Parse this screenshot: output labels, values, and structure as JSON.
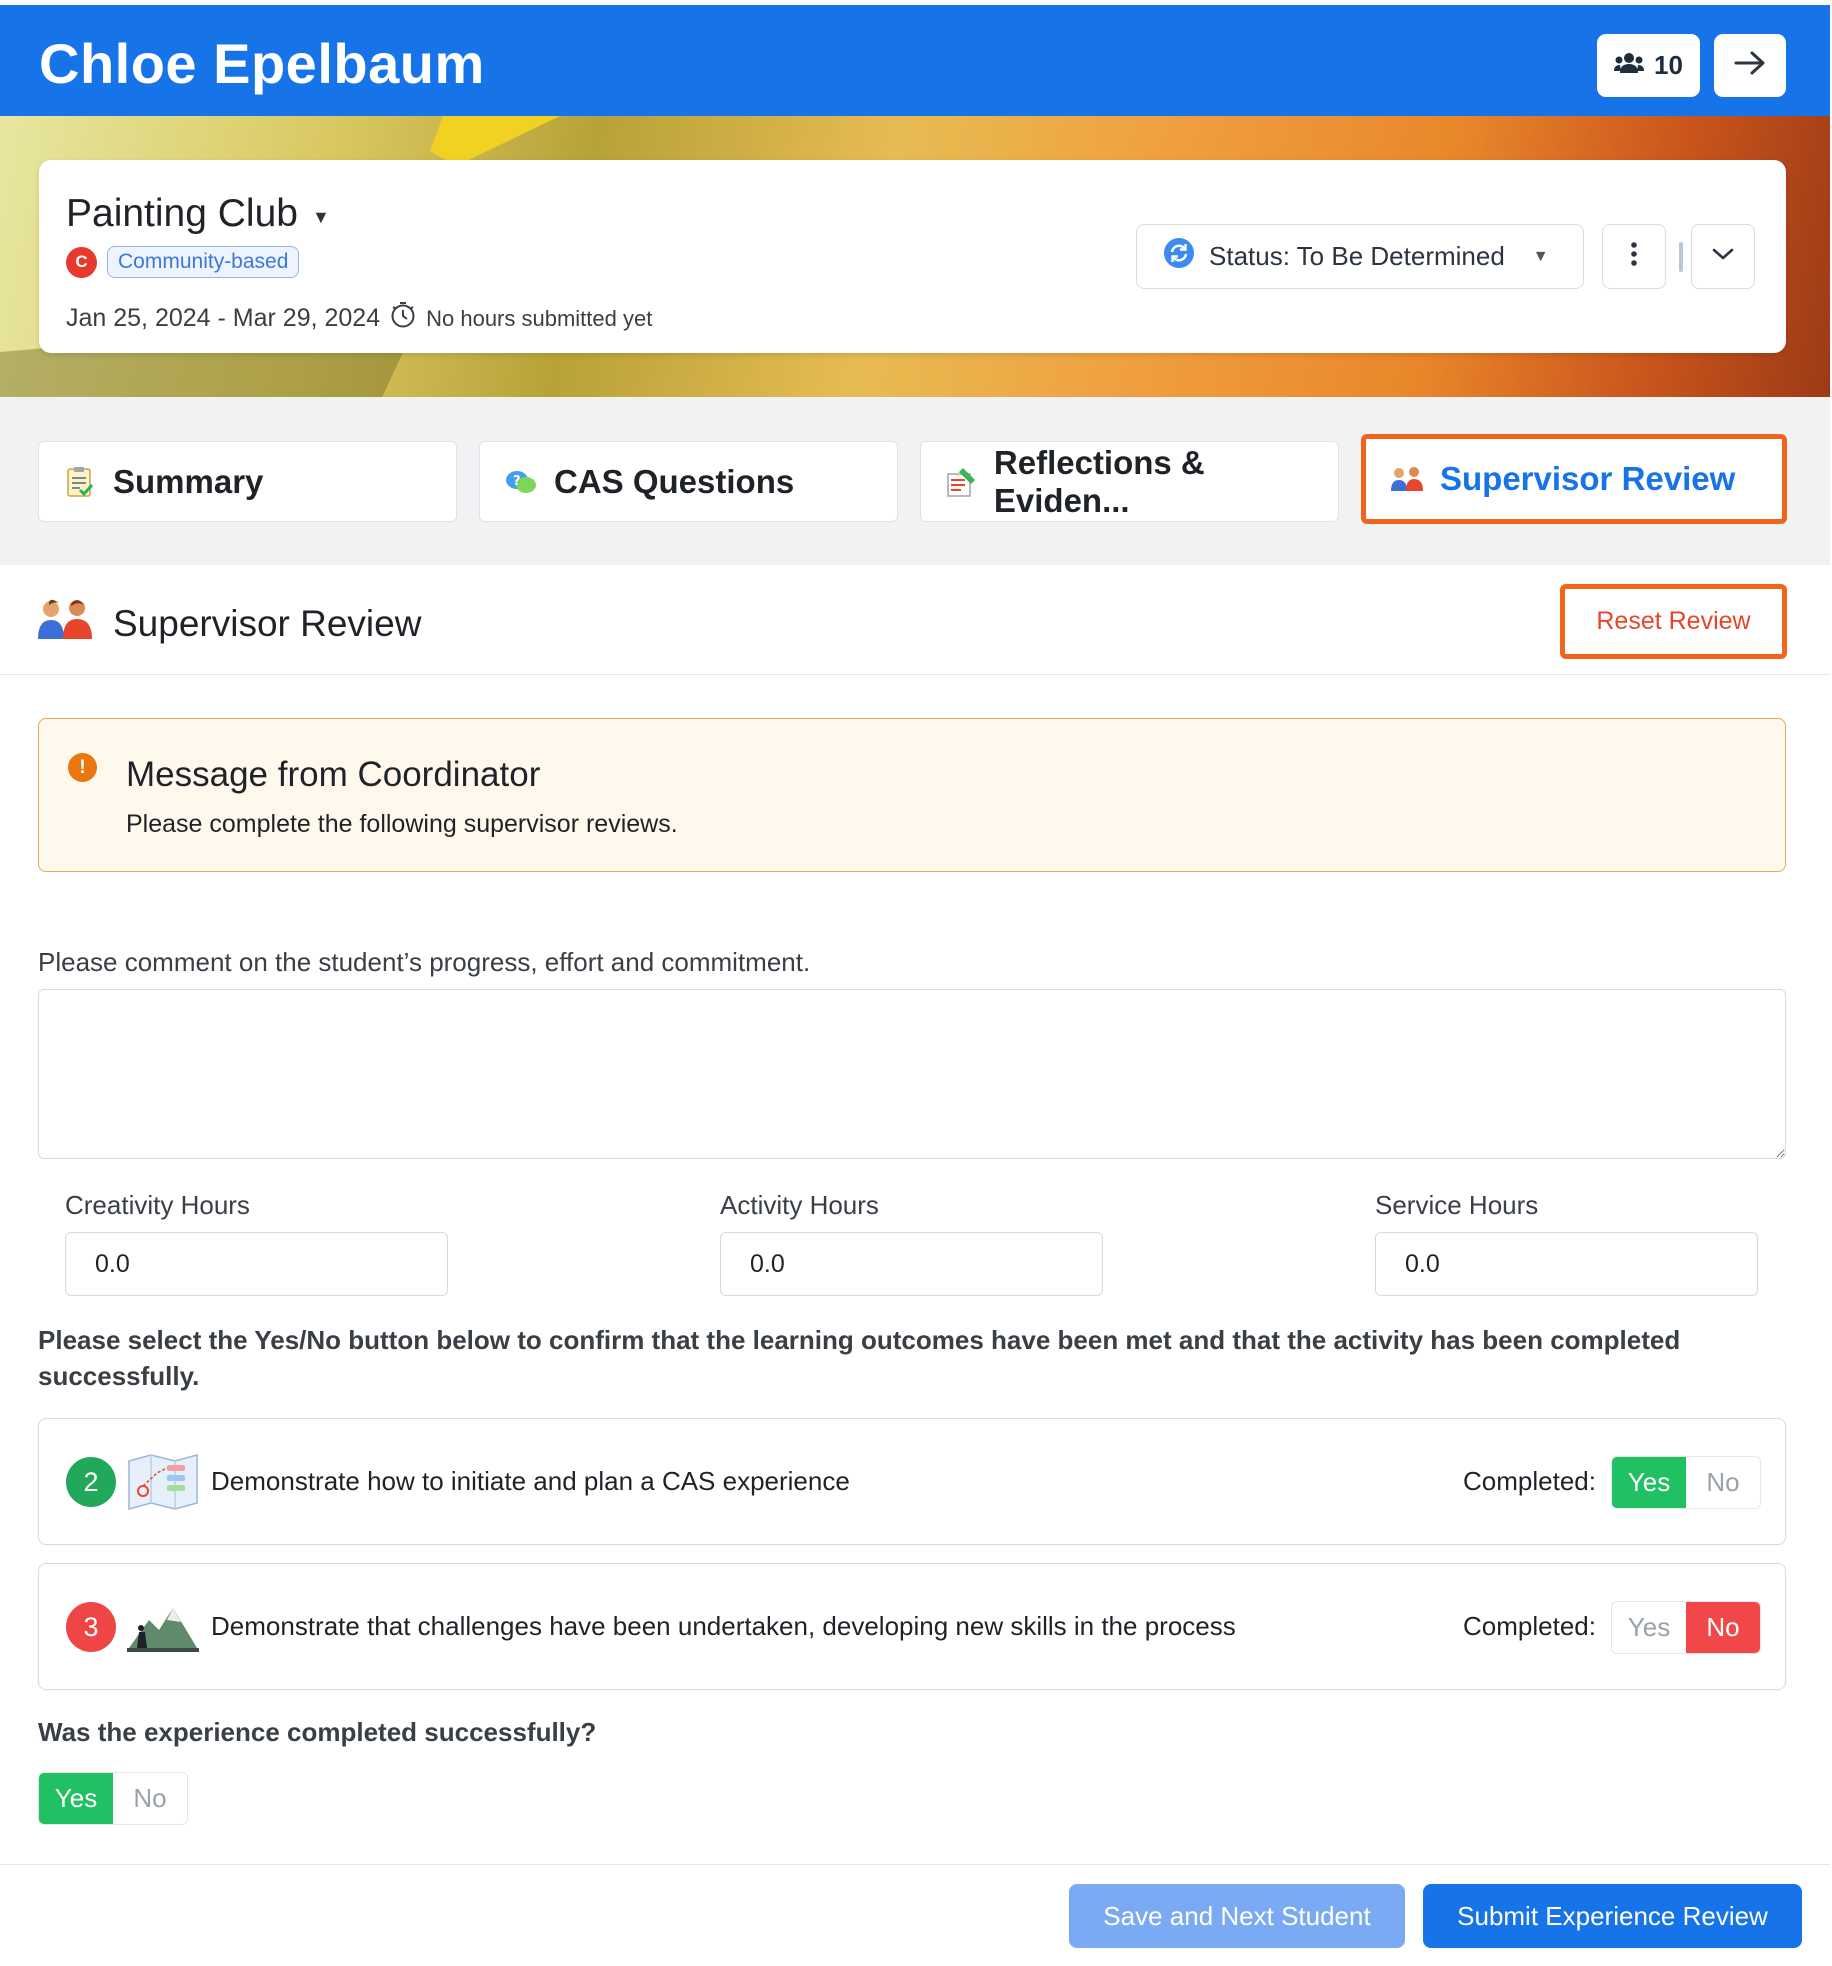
{
  "header": {
    "student_name": "Chloe Epelbaum",
    "group_count": "10",
    "group_icon": "users-icon",
    "next_icon": "arrow-right-icon"
  },
  "experience": {
    "title": "Painting Club",
    "category_badge": "C",
    "category_label": "Community-based",
    "dates": "Jan 25, 2024 - Mar 29, 2024",
    "hours_status": "No hours submitted yet",
    "status_label": "Status: To Be Determined"
  },
  "tabs": [
    {
      "label": "Summary",
      "icon": "checklist-icon"
    },
    {
      "label": "CAS Questions",
      "icon": "question-bubble-icon"
    },
    {
      "label": "Reflections & Eviden...",
      "icon": "notes-icon"
    },
    {
      "label": "Supervisor Review",
      "icon": "people-icon",
      "active": true
    }
  ],
  "section": {
    "title": "Supervisor Review",
    "reset_label": "Reset Review"
  },
  "message": {
    "title": "Message from Coordinator",
    "body": "Please complete the following supervisor reviews."
  },
  "comment": {
    "label": "Please comment on the student’s progress, effort and commitment.",
    "value": ""
  },
  "hours": {
    "creativity_label": "Creativity Hours",
    "creativity_value": "0.0",
    "activity_label": "Activity Hours",
    "activity_value": "0.0",
    "service_label": "Service Hours",
    "service_value": "0.0"
  },
  "instructions": "Please select the Yes/No button below to confirm that the learning outcomes have been met and that the activity has been completed successfully.",
  "outcomes": [
    {
      "number": "2",
      "text": "Demonstrate how to initiate and plan a CAS experience",
      "completed_label": "Completed:",
      "yes": "Yes",
      "no": "No",
      "selected": "yes",
      "color": "#21a85a"
    },
    {
      "number": "3",
      "text": "Demonstrate that challenges have been undertaken, developing new skills in the process",
      "completed_label": "Completed:",
      "yes": "Yes",
      "no": "No",
      "selected": "no",
      "color": "#ef4545"
    }
  ],
  "success": {
    "question": "Was the experience completed successfully?",
    "yes": "Yes",
    "no": "No",
    "selected": "yes"
  },
  "footer": {
    "save_next_label": "Save and Next Student",
    "submit_label": "Submit Experience Review"
  },
  "colors": {
    "brand_blue": "#1773e8",
    "highlight_orange": "#f2631c",
    "yes_green": "#21c063",
    "no_red": "#f04848"
  }
}
